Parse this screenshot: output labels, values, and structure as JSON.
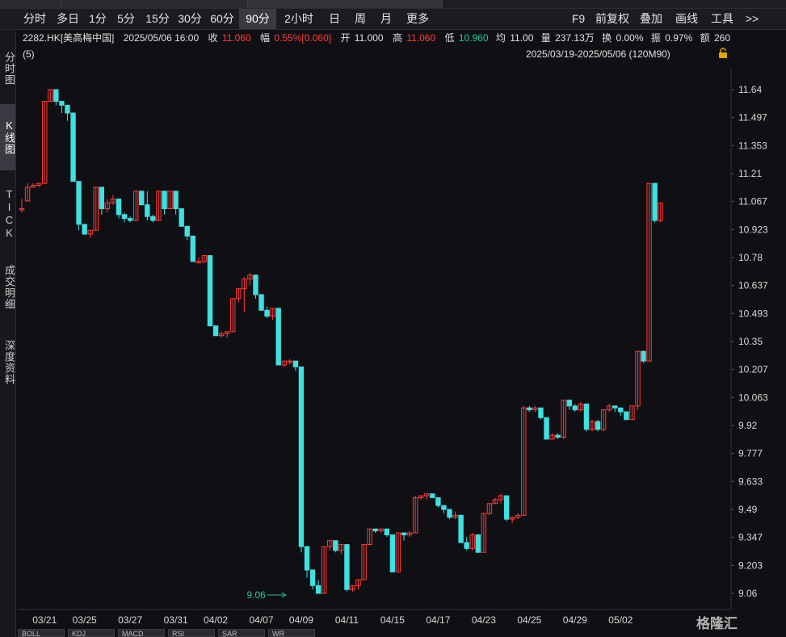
{
  "toolbar": {
    "periods": [
      "分时",
      "多日",
      "1分",
      "5分",
      "15分",
      "30分",
      "60分",
      "90分",
      "2小时",
      "日",
      "周",
      "月",
      "更多"
    ],
    "active_period": "90分",
    "right_items": [
      "F9",
      "前复权",
      "叠加",
      "画线",
      "工具",
      ">>"
    ]
  },
  "sidebar": {
    "items": [
      "分时图",
      "K线图",
      "TICK",
      "成交明细",
      "深度资料"
    ],
    "active": "K线图"
  },
  "quote": {
    "code": "2282.HK[美高梅中国]",
    "datetime": "2025/05/06 16:00",
    "close_label": "收",
    "close": "11.060",
    "change_label": "幅",
    "change_pct": "0.55%[0.060]",
    "open_label": "开",
    "open": "11.000",
    "high_label": "高",
    "high": "11.060",
    "low_label": "低",
    "low": "10.960",
    "avg_label": "均",
    "avg": "11.00",
    "volume_label": "量",
    "volume": "237.13万",
    "turnover_label": "换",
    "turnover": "0.00%",
    "amplitude_label": "振",
    "amplitude": "0.97%",
    "amount_label": "额",
    "amount": "260"
  },
  "chart_header": {
    "period_label": "(5)",
    "date_range": "2025/03/19-2025/05/06 (120M90)"
  },
  "bottom_tabs": [
    "BOLL",
    "KDJ",
    "MACD",
    "RSI",
    "SAR",
    "WR"
  ],
  "watermark": "格隆汇",
  "colors": {
    "up": "#ff3b3b",
    "down": "#3fe0e0",
    "background": "#101014",
    "low_marker": "#20c997"
  },
  "chart_data": {
    "type": "candlestick",
    "title": "",
    "xlabel": "",
    "ylabel": "",
    "ylim": [
      9.0,
      11.75
    ],
    "y_ticks": [
      "11.64",
      "11.497",
      "11.353",
      "11.21",
      "11.067",
      "10.923",
      "10.78",
      "10.637",
      "10.493",
      "10.35",
      "10.207",
      "10.063",
      "9.92",
      "9.777",
      "9.633",
      "9.49",
      "9.347",
      "9.203",
      "9.06"
    ],
    "x_tick_labels": [
      {
        "i": 4,
        "label": "03/21"
      },
      {
        "i": 11,
        "label": "03/25"
      },
      {
        "i": 19,
        "label": "03/27"
      },
      {
        "i": 27,
        "label": "03/31"
      },
      {
        "i": 34,
        "label": "04/02"
      },
      {
        "i": 42,
        "label": "04/07"
      },
      {
        "i": 49,
        "label": "04/09"
      },
      {
        "i": 57,
        "label": "04/11"
      },
      {
        "i": 65,
        "label": "04/15"
      },
      {
        "i": 73,
        "label": "04/17"
      },
      {
        "i": 81,
        "label": "04/23"
      },
      {
        "i": 89,
        "label": "04/25"
      },
      {
        "i": 97,
        "label": "04/29"
      },
      {
        "i": 105,
        "label": "05/02"
      }
    ],
    "low_annotation": {
      "i": 47,
      "value": 9.06,
      "label": "9.06"
    },
    "candles": [
      {
        "o": 11.03,
        "c": 11.03,
        "h": 11.08,
        "l": 11.01
      },
      {
        "o": 11.07,
        "c": 11.14,
        "h": 11.16,
        "l": 11.07
      },
      {
        "o": 11.14,
        "c": 11.15,
        "h": 11.16,
        "l": 11.14
      },
      {
        "o": 11.15,
        "c": 11.16,
        "h": 11.16,
        "l": 11.14
      },
      {
        "o": 11.16,
        "c": 11.58,
        "h": 11.58,
        "l": 11.16
      },
      {
        "o": 11.58,
        "c": 11.64,
        "h": 11.64,
        "l": 11.58
      },
      {
        "o": 11.64,
        "c": 11.58,
        "h": 11.64,
        "l": 11.56
      },
      {
        "o": 11.58,
        "c": 11.56,
        "h": 11.58,
        "l": 11.52
      },
      {
        "o": 11.56,
        "c": 11.52,
        "h": 11.56,
        "l": 11.48
      },
      {
        "o": 11.52,
        "c": 11.17,
        "h": 11.52,
        "l": 11.17
      },
      {
        "o": 11.17,
        "c": 10.95,
        "h": 11.17,
        "l": 10.92
      },
      {
        "o": 10.95,
        "c": 10.9,
        "h": 10.95,
        "l": 10.9
      },
      {
        "o": 10.9,
        "c": 10.92,
        "h": 10.92,
        "l": 10.88
      },
      {
        "o": 10.92,
        "c": 11.14,
        "h": 11.14,
        "l": 10.92
      },
      {
        "o": 11.14,
        "c": 11.03,
        "h": 11.14,
        "l": 11.0
      },
      {
        "o": 11.03,
        "c": 11.06,
        "h": 11.08,
        "l": 11.01
      },
      {
        "o": 11.06,
        "c": 11.08,
        "h": 11.1,
        "l": 11.05
      },
      {
        "o": 11.08,
        "c": 11.0,
        "h": 11.08,
        "l": 10.98
      },
      {
        "o": 11.0,
        "c": 10.98,
        "h": 11.01,
        "l": 10.96
      },
      {
        "o": 10.98,
        "c": 10.97,
        "h": 10.99,
        "l": 10.96
      },
      {
        "o": 10.97,
        "c": 11.12,
        "h": 11.12,
        "l": 10.97
      },
      {
        "o": 11.12,
        "c": 11.05,
        "h": 11.12,
        "l": 11.05
      },
      {
        "o": 11.05,
        "c": 10.99,
        "h": 11.12,
        "l": 10.97
      },
      {
        "o": 10.99,
        "c": 10.97,
        "h": 11.0,
        "l": 10.96
      },
      {
        "o": 10.97,
        "c": 11.12,
        "h": 11.12,
        "l": 10.97
      },
      {
        "o": 11.12,
        "c": 11.03,
        "h": 11.12,
        "l": 11.0
      },
      {
        "o": 11.03,
        "c": 11.12,
        "h": 11.12,
        "l": 11.03
      },
      {
        "o": 11.12,
        "c": 11.03,
        "h": 11.12,
        "l": 11.0
      },
      {
        "o": 11.03,
        "c": 10.94,
        "h": 11.03,
        "l": 10.94
      },
      {
        "o": 10.94,
        "c": 10.89,
        "h": 10.94,
        "l": 10.87
      },
      {
        "o": 10.89,
        "c": 10.76,
        "h": 10.89,
        "l": 10.76
      },
      {
        "o": 10.76,
        "c": 10.76,
        "h": 10.78,
        "l": 10.75
      },
      {
        "o": 10.76,
        "c": 10.79,
        "h": 10.79,
        "l": 10.75
      },
      {
        "o": 10.79,
        "c": 10.43,
        "h": 10.79,
        "l": 10.43
      },
      {
        "o": 10.43,
        "c": 10.38,
        "h": 10.43,
        "l": 10.38
      },
      {
        "o": 10.38,
        "c": 10.39,
        "h": 10.4,
        "l": 10.37
      },
      {
        "o": 10.39,
        "c": 10.4,
        "h": 10.4,
        "l": 10.37
      },
      {
        "o": 10.4,
        "c": 10.57,
        "h": 10.57,
        "l": 10.4
      },
      {
        "o": 10.57,
        "c": 10.62,
        "h": 10.62,
        "l": 10.55
      },
      {
        "o": 10.62,
        "c": 10.67,
        "h": 10.68,
        "l": 10.5
      },
      {
        "o": 10.67,
        "c": 10.69,
        "h": 10.7,
        "l": 10.64
      },
      {
        "o": 10.69,
        "c": 10.59,
        "h": 10.69,
        "l": 10.57
      },
      {
        "o": 10.59,
        "c": 10.51,
        "h": 10.59,
        "l": 10.51
      },
      {
        "o": 10.51,
        "c": 10.48,
        "h": 10.53,
        "l": 10.47
      },
      {
        "o": 10.48,
        "c": 10.52,
        "h": 10.52,
        "l": 10.46
      },
      {
        "o": 10.52,
        "c": 10.23,
        "h": 10.52,
        "l": 10.23
      },
      {
        "o": 10.23,
        "c": 10.25,
        "h": 10.25,
        "l": 10.22
      },
      {
        "o": 10.25,
        "c": 10.25,
        "h": 10.26,
        "l": 10.23
      },
      {
        "o": 10.25,
        "c": 10.22,
        "h": 10.25,
        "l": 10.2
      },
      {
        "o": 10.22,
        "c": 9.3,
        "h": 10.22,
        "l": 9.27
      },
      {
        "o": 9.3,
        "c": 9.18,
        "h": 9.3,
        "l": 9.14
      },
      {
        "o": 9.18,
        "c": 9.1,
        "h": 9.18,
        "l": 9.08
      },
      {
        "o": 9.1,
        "c": 9.06,
        "h": 9.13,
        "l": 9.06
      },
      {
        "o": 9.06,
        "c": 9.3,
        "h": 9.3,
        "l": 9.06
      },
      {
        "o": 9.3,
        "c": 9.33,
        "h": 9.33,
        "l": 9.28
      },
      {
        "o": 9.33,
        "c": 9.28,
        "h": 9.33,
        "l": 9.27
      },
      {
        "o": 9.28,
        "c": 9.31,
        "h": 9.31,
        "l": 9.26
      },
      {
        "o": 9.31,
        "c": 9.08,
        "h": 9.31,
        "l": 9.07
      },
      {
        "o": 9.08,
        "c": 9.1,
        "h": 9.1,
        "l": 9.07
      },
      {
        "o": 9.1,
        "c": 9.13,
        "h": 9.13,
        "l": 9.08
      },
      {
        "o": 9.13,
        "c": 9.31,
        "h": 9.31,
        "l": 9.13
      },
      {
        "o": 9.31,
        "c": 9.39,
        "h": 9.39,
        "l": 9.31
      },
      {
        "o": 9.39,
        "c": 9.38,
        "h": 9.39,
        "l": 9.37
      },
      {
        "o": 9.38,
        "c": 9.39,
        "h": 9.39,
        "l": 9.37
      },
      {
        "o": 9.39,
        "c": 9.36,
        "h": 9.39,
        "l": 9.35
      },
      {
        "o": 9.36,
        "c": 9.17,
        "h": 9.36,
        "l": 9.17
      },
      {
        "o": 9.17,
        "c": 9.37,
        "h": 9.37,
        "l": 9.17
      },
      {
        "o": 9.37,
        "c": 9.36,
        "h": 9.37,
        "l": 9.33
      },
      {
        "o": 9.36,
        "c": 9.37,
        "h": 9.38,
        "l": 9.35
      },
      {
        "o": 9.37,
        "c": 9.55,
        "h": 9.56,
        "l": 9.37
      },
      {
        "o": 9.55,
        "c": 9.56,
        "h": 9.56,
        "l": 9.54
      },
      {
        "o": 9.56,
        "c": 9.57,
        "h": 9.57,
        "l": 9.54
      },
      {
        "o": 9.57,
        "c": 9.55,
        "h": 9.57,
        "l": 9.55
      },
      {
        "o": 9.55,
        "c": 9.51,
        "h": 9.55,
        "l": 9.5
      },
      {
        "o": 9.51,
        "c": 9.49,
        "h": 9.51,
        "l": 9.47
      },
      {
        "o": 9.49,
        "c": 9.45,
        "h": 9.49,
        "l": 9.44
      },
      {
        "o": 9.45,
        "c": 9.46,
        "h": 9.48,
        "l": 9.44
      },
      {
        "o": 9.46,
        "c": 9.32,
        "h": 9.46,
        "l": 9.32
      },
      {
        "o": 9.32,
        "c": 9.29,
        "h": 9.35,
        "l": 9.28
      },
      {
        "o": 9.29,
        "c": 9.36,
        "h": 9.37,
        "l": 9.28
      },
      {
        "o": 9.36,
        "c": 9.27,
        "h": 9.36,
        "l": 9.27
      },
      {
        "o": 9.27,
        "c": 9.47,
        "h": 9.47,
        "l": 9.27
      },
      {
        "o": 9.47,
        "c": 9.52,
        "h": 9.52,
        "l": 9.46
      },
      {
        "o": 9.52,
        "c": 9.54,
        "h": 9.55,
        "l": 9.52
      },
      {
        "o": 9.54,
        "c": 9.56,
        "h": 9.57,
        "l": 9.52
      },
      {
        "o": 9.56,
        "c": 9.44,
        "h": 9.56,
        "l": 9.43
      },
      {
        "o": 9.44,
        "c": 9.45,
        "h": 9.45,
        "l": 9.42
      },
      {
        "o": 9.45,
        "c": 9.46,
        "h": 9.47,
        "l": 9.44
      },
      {
        "o": 9.46,
        "c": 10.01,
        "h": 10.02,
        "l": 9.46
      },
      {
        "o": 10.01,
        "c": 10.0,
        "h": 10.02,
        "l": 9.99
      },
      {
        "o": 10.0,
        "c": 10.01,
        "h": 10.02,
        "l": 9.99
      },
      {
        "o": 10.01,
        "c": 9.96,
        "h": 10.01,
        "l": 9.95
      },
      {
        "o": 9.96,
        "c": 9.85,
        "h": 9.96,
        "l": 9.85
      },
      {
        "o": 9.85,
        "c": 9.87,
        "h": 9.88,
        "l": 9.85
      },
      {
        "o": 9.87,
        "c": 9.86,
        "h": 9.88,
        "l": 9.85
      },
      {
        "o": 9.86,
        "c": 10.05,
        "h": 10.05,
        "l": 9.85
      },
      {
        "o": 10.05,
        "c": 10.02,
        "h": 10.05,
        "l": 10.0
      },
      {
        "o": 10.02,
        "c": 10.0,
        "h": 10.03,
        "l": 9.99
      },
      {
        "o": 10.0,
        "c": 10.03,
        "h": 10.04,
        "l": 9.99
      },
      {
        "o": 10.03,
        "c": 9.9,
        "h": 10.03,
        "l": 9.89
      },
      {
        "o": 9.9,
        "c": 9.94,
        "h": 9.95,
        "l": 9.89
      },
      {
        "o": 9.94,
        "c": 9.9,
        "h": 9.95,
        "l": 9.89
      },
      {
        "o": 9.9,
        "c": 10.0,
        "h": 10.0,
        "l": 9.89
      },
      {
        "o": 10.0,
        "c": 10.02,
        "h": 10.03,
        "l": 9.99
      },
      {
        "o": 10.02,
        "c": 10.01,
        "h": 10.02,
        "l": 9.99
      },
      {
        "o": 10.01,
        "c": 9.99,
        "h": 10.01,
        "l": 9.97
      },
      {
        "o": 9.99,
        "c": 9.95,
        "h": 9.99,
        "l": 9.95
      },
      {
        "o": 9.95,
        "c": 10.02,
        "h": 10.02,
        "l": 9.95
      },
      {
        "o": 10.02,
        "c": 10.3,
        "h": 10.3,
        "l": 10.0
      },
      {
        "o": 10.3,
        "c": 10.25,
        "h": 10.3,
        "l": 10.24
      },
      {
        "o": 10.25,
        "c": 11.16,
        "h": 11.16,
        "l": 10.25
      },
      {
        "o": 11.16,
        "c": 10.97,
        "h": 11.16,
        "l": 10.96
      },
      {
        "o": 10.97,
        "c": 11.06,
        "h": 11.06,
        "l": 10.96
      }
    ]
  }
}
